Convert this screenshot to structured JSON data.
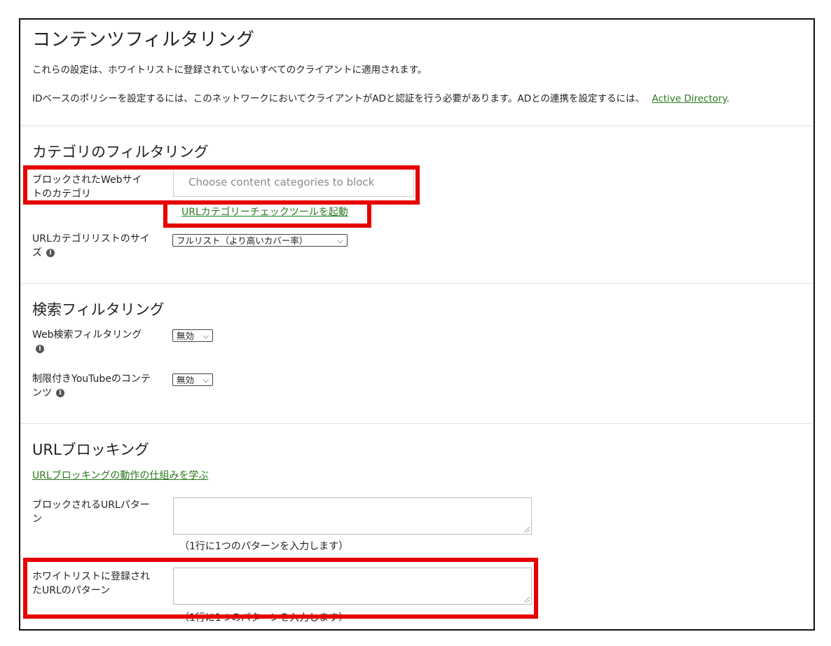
{
  "page": {
    "title": "コンテンツフィルタリング",
    "desc1": "これらの設定は、ホワイトリストに登録されていないすべてのクライアントに適用されます。",
    "desc2": "IDベースのポリシーを設定するには、このネットワークにおいてクライアントがADと認証を行う必要があります。ADとの連携を設定するには、",
    "ad_link": "Active Directory",
    "desc2_end": "."
  },
  "category": {
    "heading": "カテゴリのフィルタリング",
    "blocked_label": "ブロックされたWebサイトのカテゴリ",
    "blocked_placeholder": "Choose content categories to block",
    "checker_link": "URLカテゴリーチェックツールを起動",
    "list_size_label": "URLカテゴリリストのサイズ",
    "list_size_value": "フルリスト（より高いカバー率）"
  },
  "search": {
    "heading": "検索フィルタリング",
    "web_label": "Web検索フィルタリング",
    "web_value": "無効",
    "youtube_label": "制限付きYouTubeのコンテンツ",
    "youtube_value": "無効"
  },
  "url": {
    "heading": "URLブロッキング",
    "learn_link": "URLブロッキングの動作の仕組みを学ぶ",
    "blocked_label": "ブロックされるURLパターン",
    "blocked_hint": "（1行に1つのパターンを入力します）",
    "whitelist_label": "ホワイトリストに登録されたURLのパターン",
    "whitelist_hint": "（1行に1つのパターンを入力します）"
  },
  "colors": {
    "link": "#2a7a1e",
    "highlight": "#e60000",
    "text": "#222222"
  },
  "icons": [
    "info-icon",
    "chevron-down-icon",
    "resize-grip-icon"
  ]
}
